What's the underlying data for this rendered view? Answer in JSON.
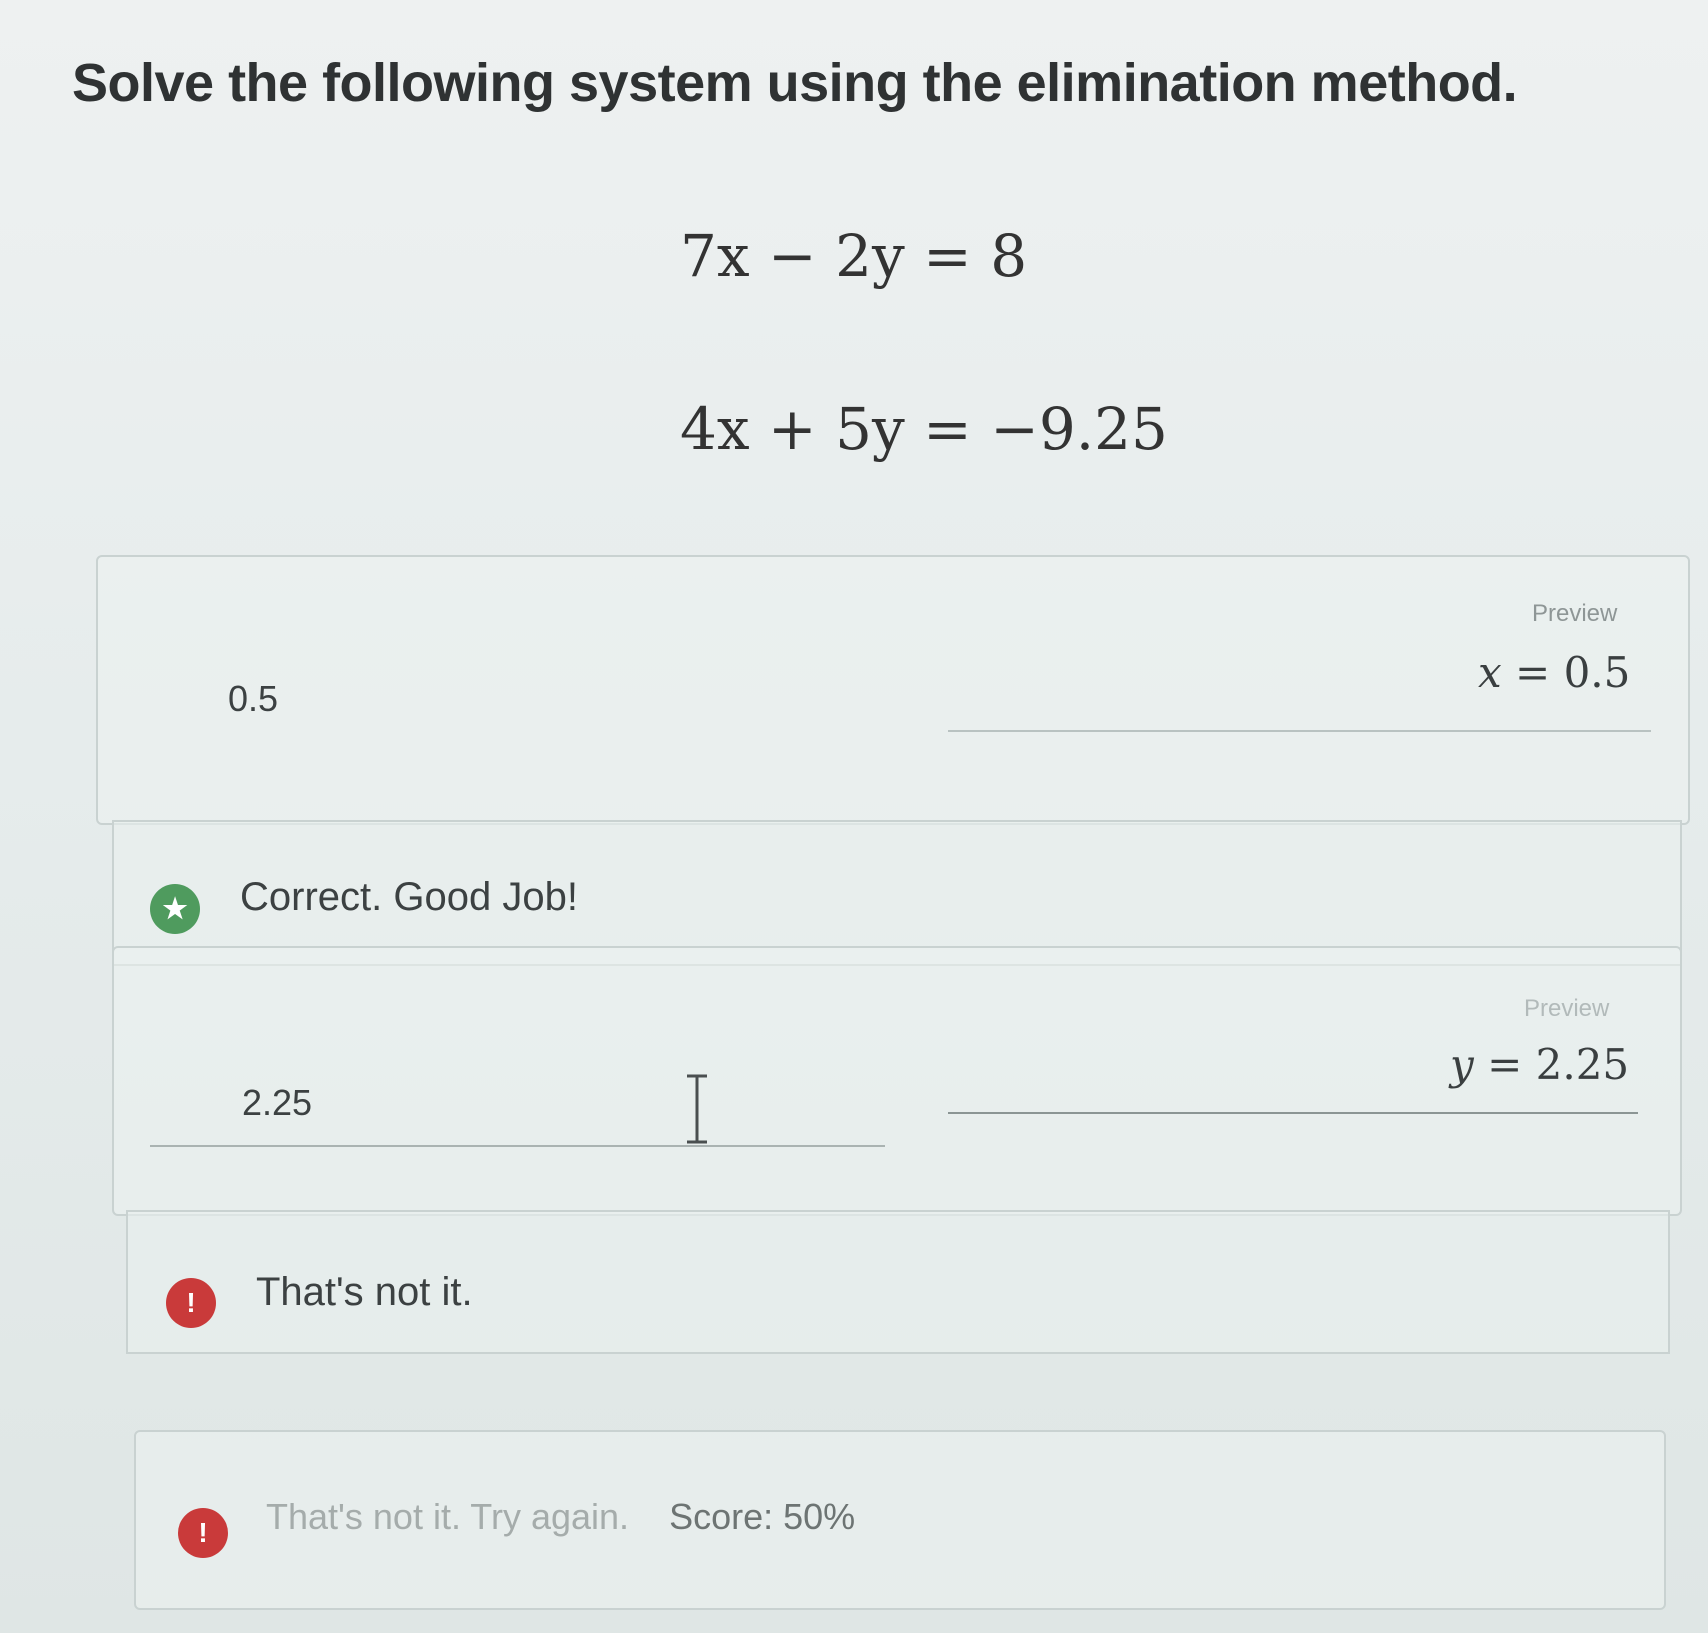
{
  "question": {
    "title": "Solve the following system using the elimination method.",
    "equations": [
      "7x − 2y = 8",
      "4x + 5y = −9.25"
    ]
  },
  "answer_x": {
    "input_value": "0.5",
    "preview_label": "Preview",
    "preview_var": "x",
    "preview_value": "= 0.5",
    "feedback": "Correct. Good Job!",
    "feedback_icon": "star-icon",
    "feedback_color": "#4f9b5e"
  },
  "answer_y": {
    "input_value": "2.25",
    "preview_label": "Preview",
    "preview_var": "y",
    "preview_value": "= 2.25",
    "feedback": "That's not it.",
    "feedback_icon": "exclamation-icon",
    "feedback_color": "#c93a3a"
  },
  "result": {
    "message": "That's not it. Try again.",
    "score": "Score: 50%",
    "icon": "exclamation-icon",
    "color": "#c93a3a"
  }
}
